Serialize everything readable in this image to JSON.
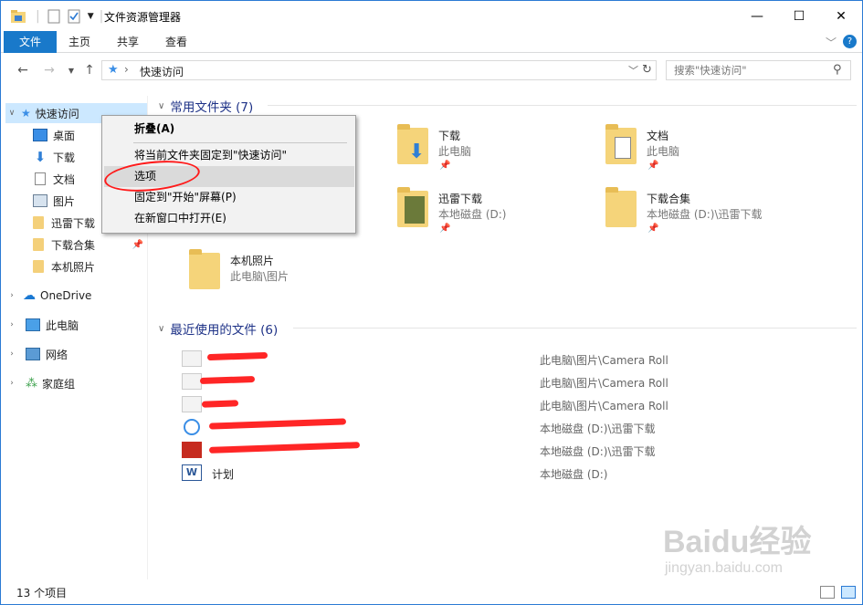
{
  "window": {
    "title": "文件资源管理器",
    "controls": {
      "minimize": "—",
      "maximize": "☐",
      "close": "✕"
    }
  },
  "ribbon": {
    "tabs": [
      "文件",
      "主页",
      "共享",
      "查看"
    ]
  },
  "address": {
    "path_segment": "快速访问",
    "separator": "›"
  },
  "search": {
    "placeholder": "搜索\"快速访问\""
  },
  "sidebar": {
    "items": [
      {
        "label": "快速访问",
        "icon": "star-icon"
      },
      {
        "label": "桌面",
        "icon": "desktop-icon"
      },
      {
        "label": "下载",
        "icon": "download-arrow-icon"
      },
      {
        "label": "文档",
        "icon": "document-icon"
      },
      {
        "label": "图片",
        "icon": "pictures-icon"
      },
      {
        "label": "迅雷下载",
        "icon": "folder-icon"
      },
      {
        "label": "下载合集",
        "icon": "folder-icon"
      },
      {
        "label": "本机照片",
        "icon": "folder-icon"
      },
      {
        "label": "OneDrive",
        "icon": "cloud-icon"
      },
      {
        "label": "此电脑",
        "icon": "computer-icon"
      },
      {
        "label": "网络",
        "icon": "network-icon"
      },
      {
        "label": "家庭组",
        "icon": "homegroup-icon"
      }
    ]
  },
  "frequent": {
    "header": "常用文件夹 (7)",
    "folders": [
      {
        "name": "下载",
        "sub": "此电脑"
      },
      {
        "name": "文档",
        "sub": "此电脑"
      },
      {
        "name": "迅雷下载",
        "sub": "本地磁盘 (D:)"
      },
      {
        "name": "下载合集",
        "sub": "本地磁盘 (D:)\\迅雷下载"
      },
      {
        "name": "本机照片",
        "sub": "此电脑\\图片"
      }
    ]
  },
  "recent": {
    "header": "最近使用的文件 (6)",
    "files": [
      {
        "name": "",
        "path": "此电脑\\图片\\Camera Roll"
      },
      {
        "name": "",
        "path": "此电脑\\图片\\Camera Roll"
      },
      {
        "name": "",
        "path": "此电脑\\图片\\Camera Roll"
      },
      {
        "name": "",
        "path": "本地磁盘 (D:)\\迅雷下载"
      },
      {
        "name": "",
        "path": "本地磁盘 (D:)\\迅雷下载"
      },
      {
        "name": "计划",
        "path": "本地磁盘 (D:)"
      }
    ]
  },
  "context_menu": {
    "items": [
      "折叠(A)",
      "将当前文件夹固定到\"快速访问\"",
      "选项",
      "固定到\"开始\"屏幕(P)",
      "在新窗口中打开(E)"
    ]
  },
  "status": {
    "count": "13 个项目"
  },
  "watermark": {
    "brand": "Baidu经验",
    "url": "jingyan.baidu.com"
  },
  "colors": {
    "accent": "#1979ca",
    "selection": "#cce8ff",
    "section_header": "#1e3287",
    "annotation": "#ff1a1a"
  }
}
